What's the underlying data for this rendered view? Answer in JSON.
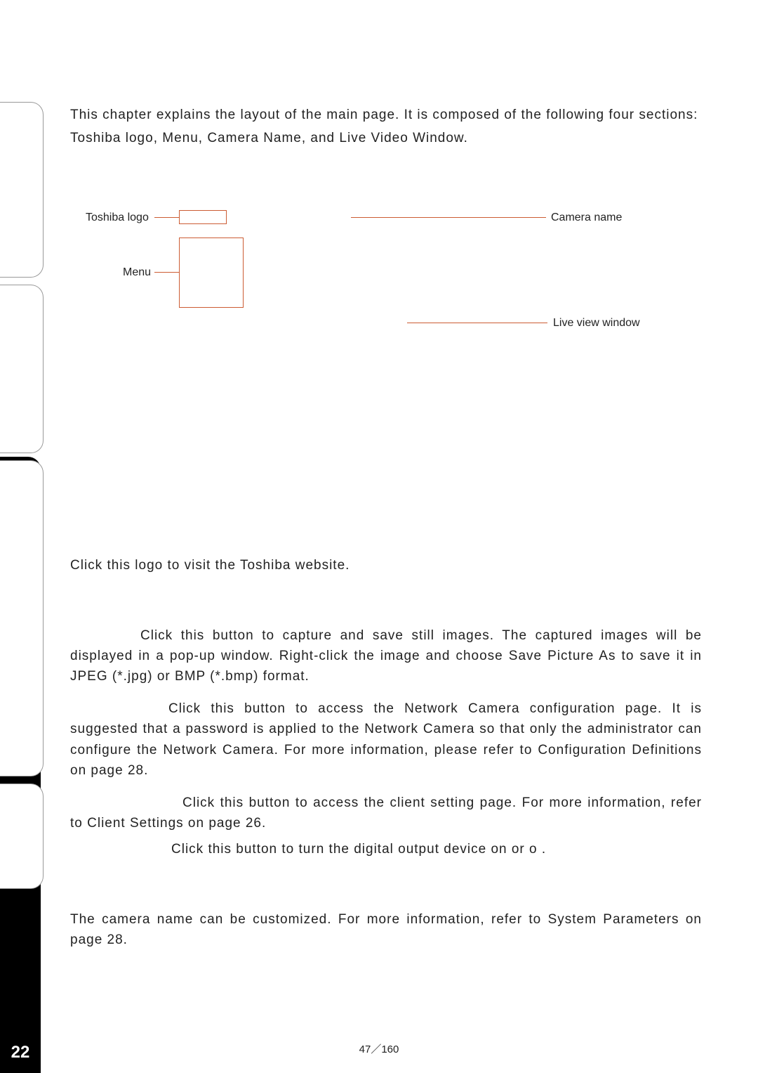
{
  "page_number": "22",
  "pager": "47／160",
  "intro": {
    "line1": "This chapter explains the layout of the main page. It is composed of the following four sections:",
    "line2": "Toshiba logo, Menu, Camera Name, and Live Video Window."
  },
  "diagram": {
    "toshiba_logo": "Toshiba logo",
    "menu": "Menu",
    "camera_name": "Camera name",
    "live_view": "Live view window"
  },
  "logo_text": "Click this logo to visit the Toshiba website.",
  "snapshot": {
    "p": "Click this button to capture and save still images. The captured images will be displayed in a pop-up window. Right-click the image and choose Save Picture As to save it in JPEG (*.jpg) or BMP (*.bmp) format."
  },
  "config": {
    "p": "Click this button to access the Network Camera configuration page. It is suggested that a password is applied to the Network Camera so that only the administrator can configure the Network Camera. For more information, please refer to Configuration Definitions on page 28."
  },
  "client": {
    "p": "Click this button to access the client setting page. For more information, refer to Client Settings on page 26."
  },
  "digital_out": {
    "p": "Click this button to turn the digital output device on or o ."
  },
  "camera_name_text": "The camera name can be customized. For more information, refer to System Parameters on page 28."
}
